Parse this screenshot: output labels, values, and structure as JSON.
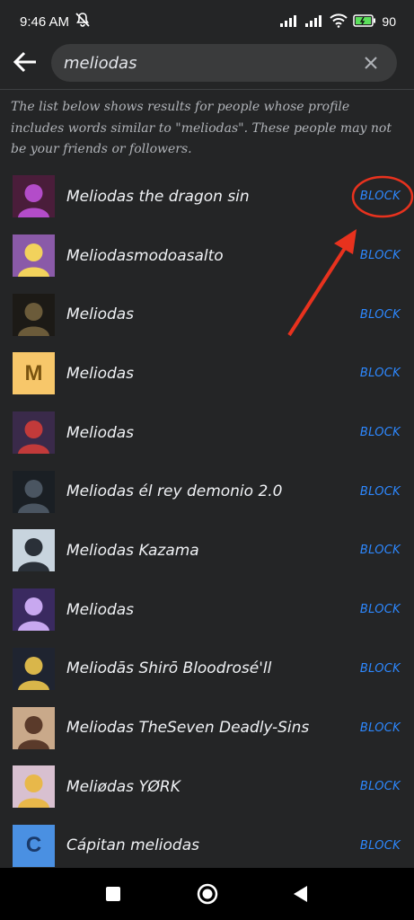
{
  "status": {
    "time": "9:46 AM",
    "battery": "90"
  },
  "search": {
    "query": "meliodas"
  },
  "info_text": "The list below shows results for people whose profile includes words similar to \"meliodas\". These people may not be your friends or followers.",
  "block_label": "BLOCK",
  "results": [
    {
      "name": "Meliodas the dragon sin",
      "avatar_bg": "#4a1d3a",
      "avatar_fg": "#b34cc9",
      "avatar_letter": ""
    },
    {
      "name": "Meliodasmodoasalto",
      "avatar_bg": "#8a5aa8",
      "avatar_fg": "#f2d25c",
      "avatar_letter": ""
    },
    {
      "name": "Meliodas",
      "avatar_bg": "#1c1a16",
      "avatar_fg": "#6b5b3a",
      "avatar_letter": ""
    },
    {
      "name": "Meliodas",
      "avatar_bg": "#f7c76a",
      "avatar_fg": "#7a5410",
      "avatar_letter": "M"
    },
    {
      "name": "Meliodas",
      "avatar_bg": "#3a2a4a",
      "avatar_fg": "#c23a3a",
      "avatar_letter": ""
    },
    {
      "name": "Meliodas él rey demonio 2.0",
      "avatar_bg": "#1a1f24",
      "avatar_fg": "#4a5561",
      "avatar_letter": ""
    },
    {
      "name": "Meliodas Kazama",
      "avatar_bg": "#c8d4de",
      "avatar_fg": "#2a3038",
      "avatar_letter": ""
    },
    {
      "name": "Meliodas",
      "avatar_bg": "#3a2a60",
      "avatar_fg": "#c8a8f0",
      "avatar_letter": ""
    },
    {
      "name": "Meliodās Shirō Bloodrosé'll",
      "avatar_bg": "#1f2430",
      "avatar_fg": "#d9b64a",
      "avatar_letter": ""
    },
    {
      "name": "Meliodas TheSeven Deadly-Sins",
      "avatar_bg": "#c9a98a",
      "avatar_fg": "#5a3a2a",
      "avatar_letter": ""
    },
    {
      "name": "Meliødas YØRK",
      "avatar_bg": "#d8c0d0",
      "avatar_fg": "#e8b84a",
      "avatar_letter": ""
    },
    {
      "name": "Cápitan meliodas",
      "avatar_bg": "#4a90e2",
      "avatar_fg": "#1a3a6a",
      "avatar_letter": "C"
    }
  ],
  "colors": {
    "accent": "#2d88ff",
    "annotation": "#e8321e",
    "background": "#242526"
  }
}
